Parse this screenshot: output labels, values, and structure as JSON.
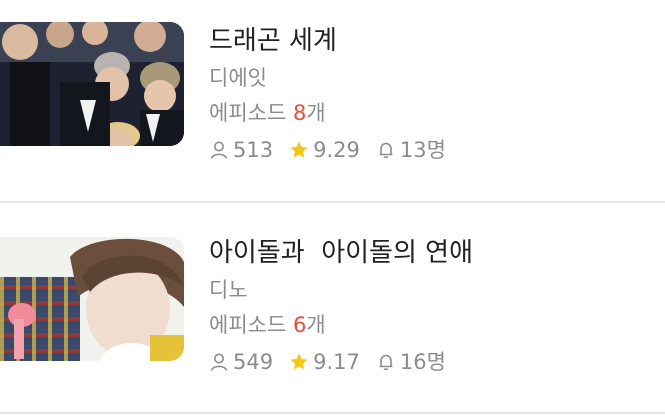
{
  "items": [
    {
      "title": "드래곤 세계",
      "author": "디에잇",
      "episodes_label": "에피소드",
      "episodes_count": "8",
      "episodes_unit": "개",
      "views": "513",
      "rating": "9.29",
      "subscribers": "13명",
      "thumbnail": "group-photo"
    },
    {
      "title": "아이돌과  아이돌의 연애",
      "author": "디노",
      "episodes_label": "에피소드",
      "episodes_count": "6",
      "episodes_unit": "개",
      "views": "549",
      "rating": "9.17",
      "subscribers": "16명",
      "thumbnail": "portrait-photo"
    }
  ],
  "icons": {
    "views": "person-icon",
    "rating": "star-icon",
    "subscribers": "bell-icon"
  },
  "colors": {
    "episode_count": "#e74c3c",
    "star": "#f5c518",
    "meta": "#8c8c8c",
    "title": "#222222"
  }
}
